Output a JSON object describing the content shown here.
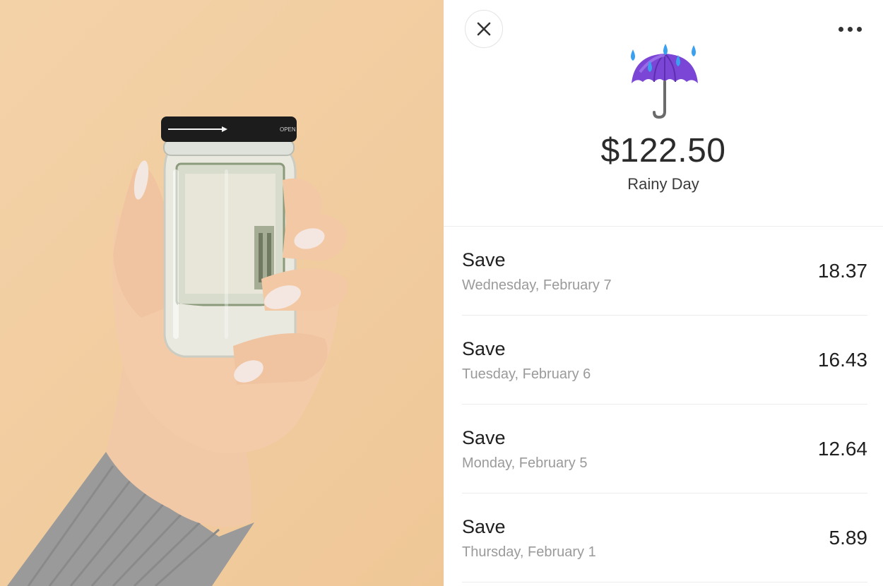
{
  "header": {
    "close_icon": "close-icon",
    "more_icon": "more-horizontal-icon"
  },
  "jar": {
    "icon": "umbrella-with-rain-drops-icon",
    "balance": "$122.50",
    "name": "Rainy Day"
  },
  "transactions": [
    {
      "title": "Save",
      "date": "Wednesday, February 7",
      "amount": "18.37"
    },
    {
      "title": "Save",
      "date": "Tuesday, February 6",
      "amount": "16.43"
    },
    {
      "title": "Save",
      "date": "Monday, February 5",
      "amount": "12.64"
    },
    {
      "title": "Save",
      "date": "Thursday, February 1",
      "amount": "5.89"
    }
  ],
  "photo": {
    "jar_lid_text": "OPEN",
    "description_icon": "hand-holding-money-jar-photo"
  },
  "colors": {
    "photo_background": "#f2cea3",
    "umbrella": "#7b45d6",
    "raindrop": "#3aa0f0",
    "text_primary": "#1f1f1f",
    "text_secondary": "#9a9a9a"
  }
}
